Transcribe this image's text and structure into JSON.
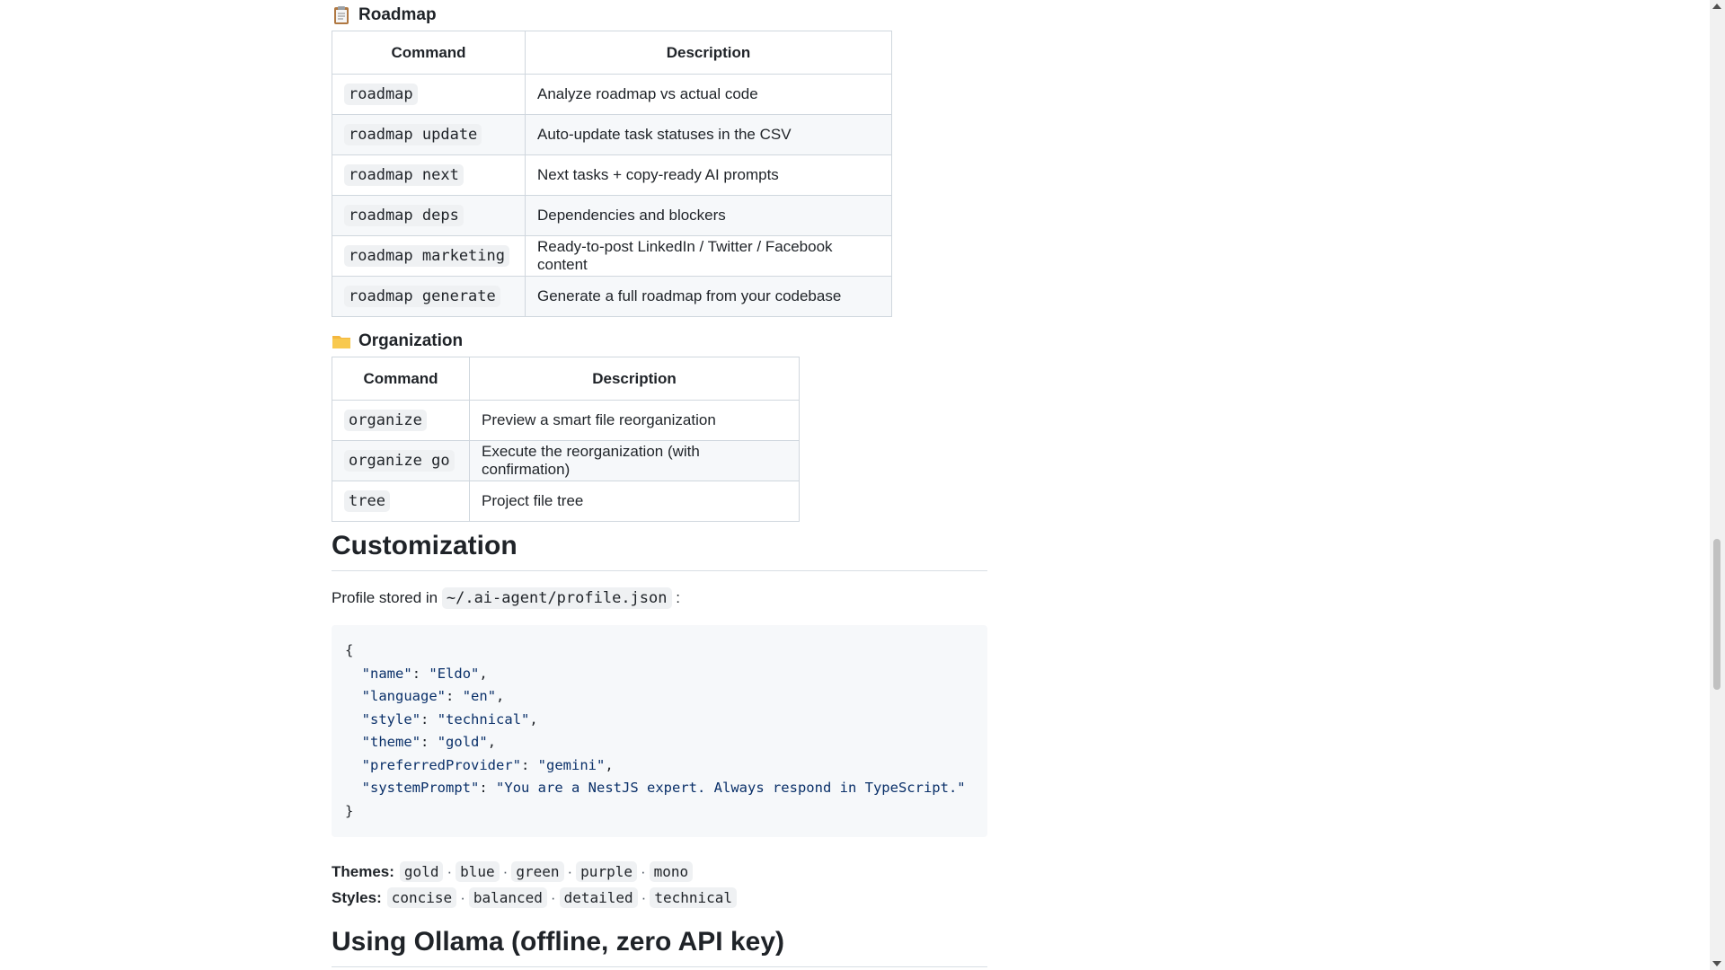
{
  "roadmap": {
    "heading": "Roadmap",
    "icon": "clipboard-icon",
    "headers": [
      "Command",
      "Description"
    ],
    "rows": [
      {
        "command": "roadmap",
        "description": "Analyze roadmap vs actual code"
      },
      {
        "command": "roadmap update",
        "description": "Auto-update task statuses in the CSV"
      },
      {
        "command": "roadmap next",
        "description": "Next tasks + copy-ready AI prompts"
      },
      {
        "command": "roadmap deps",
        "description": "Dependencies and blockers"
      },
      {
        "command": "roadmap marketing",
        "description": "Ready-to-post LinkedIn / Twitter / Facebook content"
      },
      {
        "command": "roadmap generate",
        "description": "Generate a full roadmap from your codebase"
      }
    ]
  },
  "organization": {
    "heading": "Organization",
    "icon": "folder-icon",
    "headers": [
      "Command",
      "Description"
    ],
    "rows": [
      {
        "command": "organize",
        "description": "Preview a smart file reorganization"
      },
      {
        "command": "organize go",
        "description": "Execute the reorganization (with confirmation)"
      },
      {
        "command": "tree",
        "description": "Project file tree"
      }
    ]
  },
  "customization": {
    "heading": "Customization",
    "profile_prefix": "Profile stored in",
    "profile_path": "~/.ai-agent/profile.json",
    "profile_suffix": ":",
    "code_lines": [
      {
        "key": "name",
        "value": "Eldo"
      },
      {
        "key": "language",
        "value": "en"
      },
      {
        "key": "style",
        "value": "technical"
      },
      {
        "key": "theme",
        "value": "gold"
      },
      {
        "key": "preferredProvider",
        "value": "gemini"
      },
      {
        "key": "systemPrompt",
        "value": "You are a NestJS expert. Always respond in TypeScript."
      }
    ],
    "themes_label": "Themes:",
    "themes": [
      "gold",
      "blue",
      "green",
      "purple",
      "mono"
    ],
    "styles_label": "Styles:",
    "styles": [
      "concise",
      "balanced",
      "detailed",
      "technical"
    ]
  },
  "next_heading": "Using Ollama (offline, zero API key)",
  "colors": {
    "table_border": "#d0d7de",
    "stripe": "#f6f8fa",
    "code_bg": "#eff1f3"
  }
}
